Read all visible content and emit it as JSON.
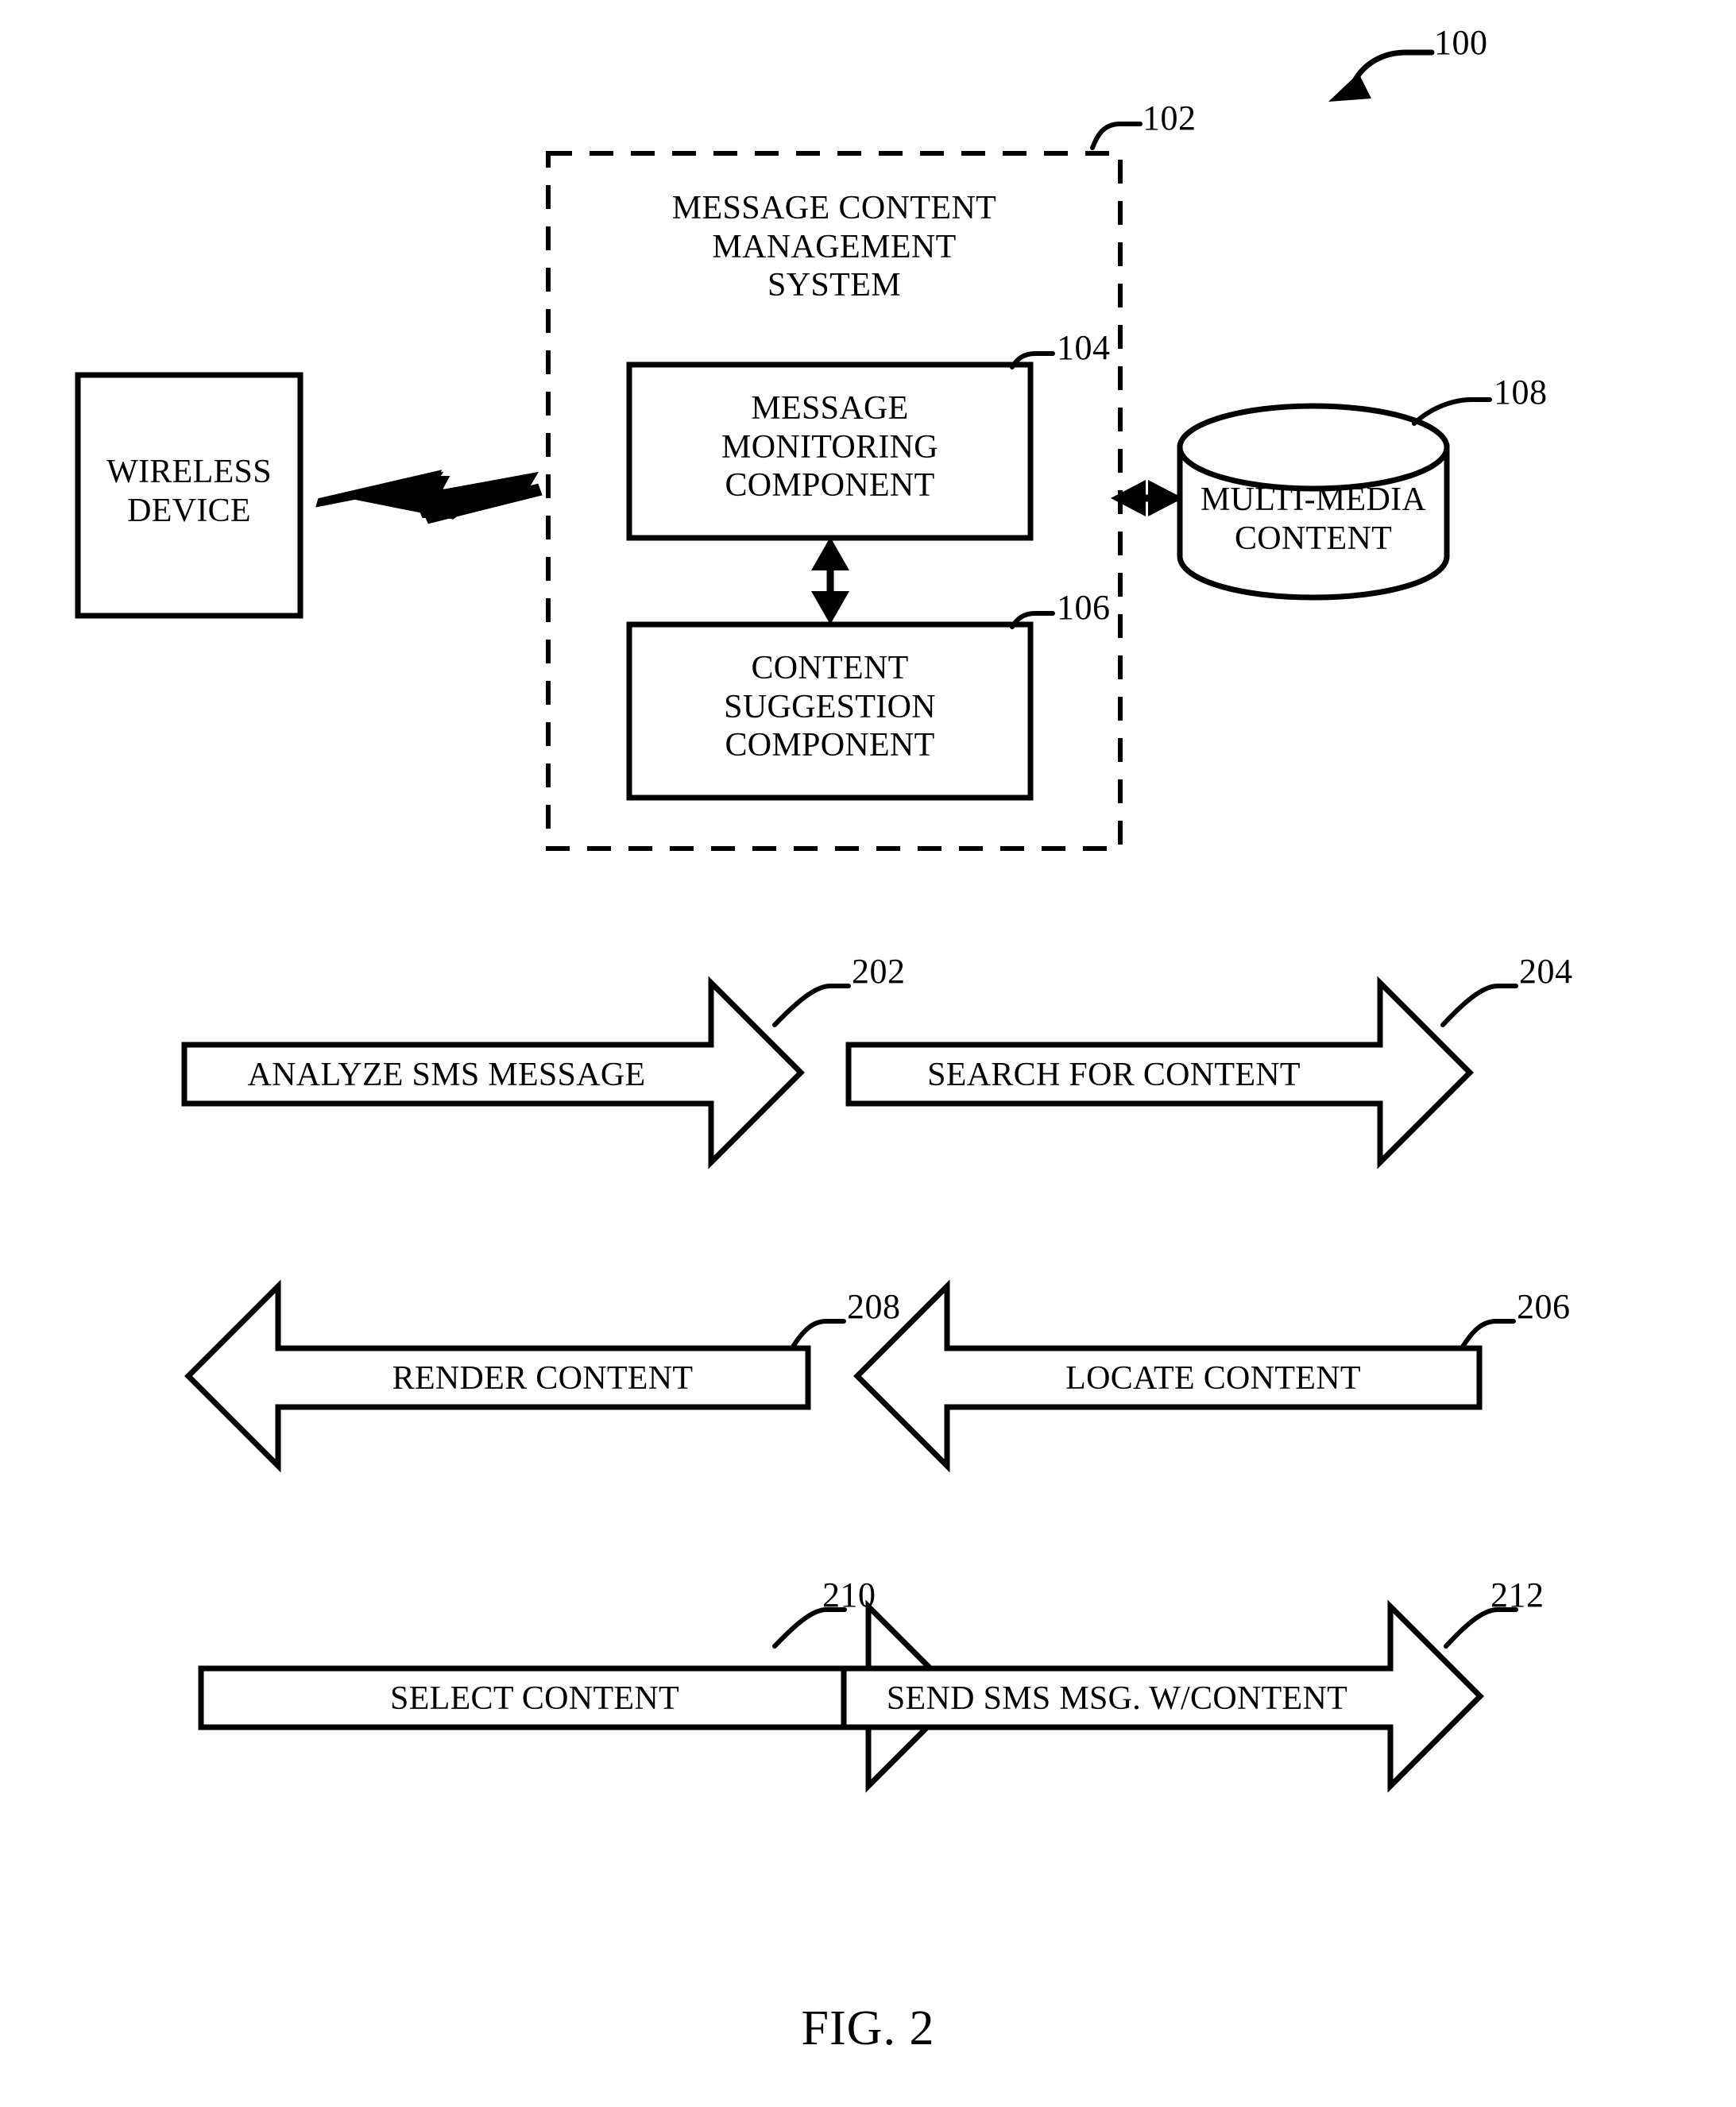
{
  "figure": {
    "caption": "FIG. 2",
    "system_ref": "100"
  },
  "system_block": {
    "title_line1": "MESSAGE CONTENT",
    "title_line2": "MANAGEMENT",
    "title_line3": "SYSTEM",
    "ref": "102"
  },
  "wireless_device": {
    "line1": "WIRELESS",
    "line2": "DEVICE"
  },
  "components": [
    {
      "line1": "MESSAGE",
      "line2": "MONITORING",
      "line3": "COMPONENT",
      "ref": "104"
    },
    {
      "line1": "CONTENT",
      "line2": "SUGGESTION",
      "line3": "COMPONENT",
      "ref": "106"
    }
  ],
  "database": {
    "line1": "MULTI-MEDIA",
    "line2": "CONTENT",
    "ref": "108"
  },
  "flow_steps": [
    {
      "label": "ANALYZE SMS MESSAGE",
      "ref": "202",
      "direction": "right"
    },
    {
      "label": "SEARCH FOR CONTENT",
      "ref": "204",
      "direction": "right"
    },
    {
      "label": "RENDER CONTENT",
      "ref": "208",
      "direction": "left"
    },
    {
      "label": "LOCATE CONTENT",
      "ref": "206",
      "direction": "left"
    },
    {
      "label": "SELECT CONTENT",
      "ref": "210",
      "direction": "right"
    },
    {
      "label": "SEND SMS MSG. W/CONTENT",
      "ref": "212",
      "direction": "right"
    }
  ],
  "colors": {
    "stroke": "#000000",
    "background": "#ffffff"
  }
}
